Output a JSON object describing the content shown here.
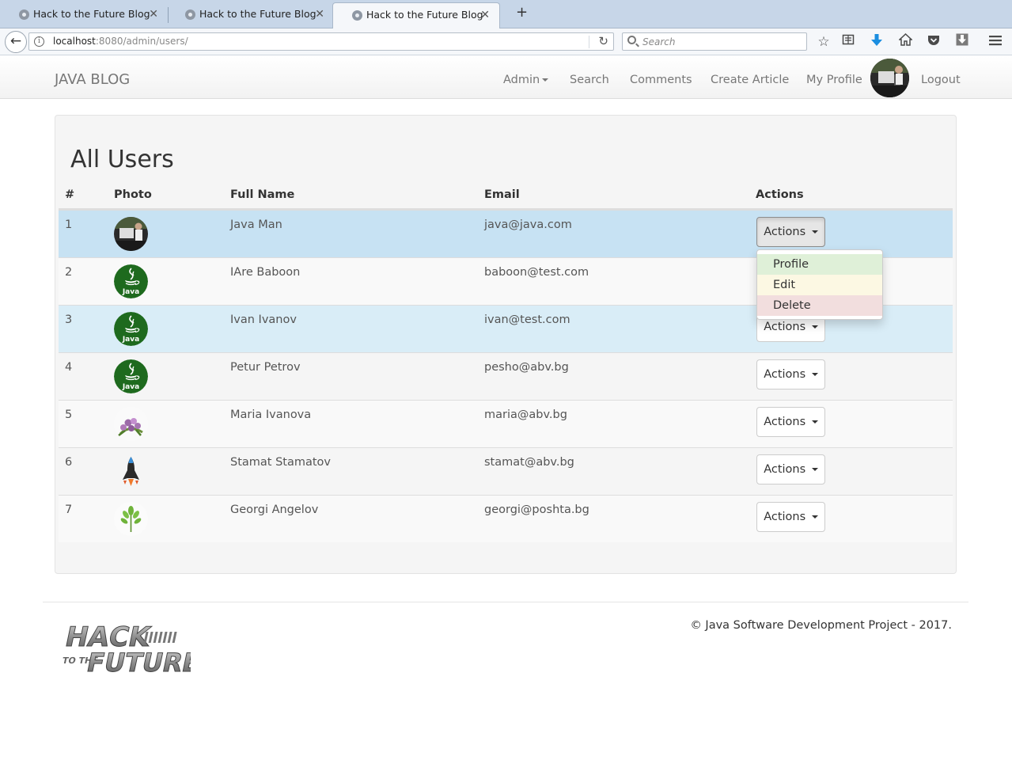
{
  "browser": {
    "tabs": [
      {
        "title": "Hack to the Future Blog",
        "active": false
      },
      {
        "title": "Hack to the Future Blog",
        "active": false
      },
      {
        "title": "Hack to the Future Blog",
        "active": true
      }
    ],
    "url_host": "localhost",
    "url_rest": ":8080/admin/users/",
    "search_placeholder": "Search"
  },
  "nav": {
    "brand": "JAVA BLOG",
    "admin": "Admin",
    "search": "Search",
    "comments": "Comments",
    "create_article": "Create Article",
    "my_profile": "My Profile",
    "logout": "Logout"
  },
  "page": {
    "title": "All Users",
    "columns": [
      "#",
      "Photo",
      "Full Name",
      "Email",
      "Actions"
    ]
  },
  "users": [
    {
      "num": "1",
      "name": "Java Man",
      "email": "java@java.com",
      "photo": "person-photo"
    },
    {
      "num": "2",
      "name": "IAre Baboon",
      "email": "baboon@test.com",
      "photo": "java-logo"
    },
    {
      "num": "3",
      "name": "Ivan Ivanov",
      "email": "ivan@test.com",
      "photo": "java-logo"
    },
    {
      "num": "4",
      "name": "Petur Petrov",
      "email": "pesho@abv.bg",
      "photo": "java-logo"
    },
    {
      "num": "5",
      "name": "Maria Ivanova",
      "email": "maria@abv.bg",
      "photo": "flowers-photo"
    },
    {
      "num": "6",
      "name": "Stamat Stamatov",
      "email": "stamat@abv.bg",
      "photo": "rocket-photo"
    },
    {
      "num": "7",
      "name": "Georgi Angelov",
      "email": "georgi@poshta.bg",
      "photo": "plant-photo"
    }
  ],
  "actions_label": "Actions",
  "dropdown": {
    "profile": "Profile",
    "edit": "Edit",
    "delete": "Delete"
  },
  "java_logo_text": "Java",
  "footer": {
    "copyright": "© Java Software Development Project - 2017.",
    "logo_line1": "HACK",
    "logo_line2": "TO THE",
    "logo_line3": "FUTURE"
  },
  "colors": {
    "row_highlight": "#c7e2f3",
    "row_info": "#d9edf7",
    "dropdown_profile": "#dff0d8",
    "dropdown_edit": "#fcf8e3",
    "dropdown_delete": "#f2dede",
    "java_green": "#1e6a1e"
  }
}
